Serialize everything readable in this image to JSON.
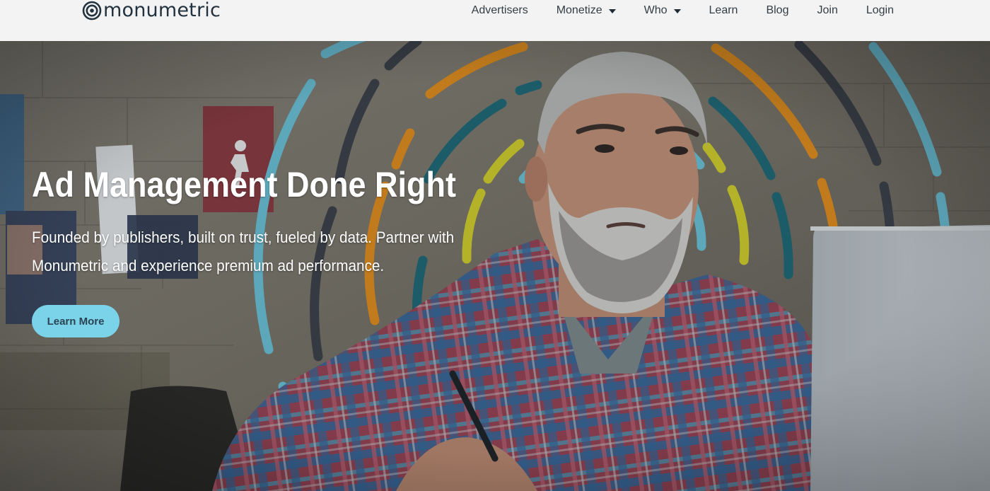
{
  "header": {
    "logo_text": "monumetric",
    "nav": [
      {
        "label": "Advertisers",
        "has_dropdown": false
      },
      {
        "label": "Monetize",
        "has_dropdown": true
      },
      {
        "label": "Who",
        "has_dropdown": true
      },
      {
        "label": "Learn",
        "has_dropdown": false
      },
      {
        "label": "Blog",
        "has_dropdown": false
      },
      {
        "label": "Join",
        "has_dropdown": false
      },
      {
        "label": "Login",
        "has_dropdown": false
      }
    ]
  },
  "hero": {
    "title": "Ad Management Done Right",
    "subtitle_line1": "Founded by publishers, built on trust, fueled by data. Partner with",
    "subtitle_line2": "Monumetric and experience premium ad performance.",
    "cta_label": "Learn More"
  },
  "colors": {
    "header_bg": "#f8f8f8",
    "logo": "#22323e",
    "cta_bg": "#7ad3e8",
    "arc_cyan": "#6ec6dc",
    "arc_orange": "#e8901c",
    "arc_teal": "#1f6a78",
    "arc_yellow": "#d8d42a",
    "arc_charcoal": "#3e4048"
  },
  "icons": {
    "logo_mark": "concentric-circles-logo-icon",
    "dropdown": "caret-down-icon"
  }
}
